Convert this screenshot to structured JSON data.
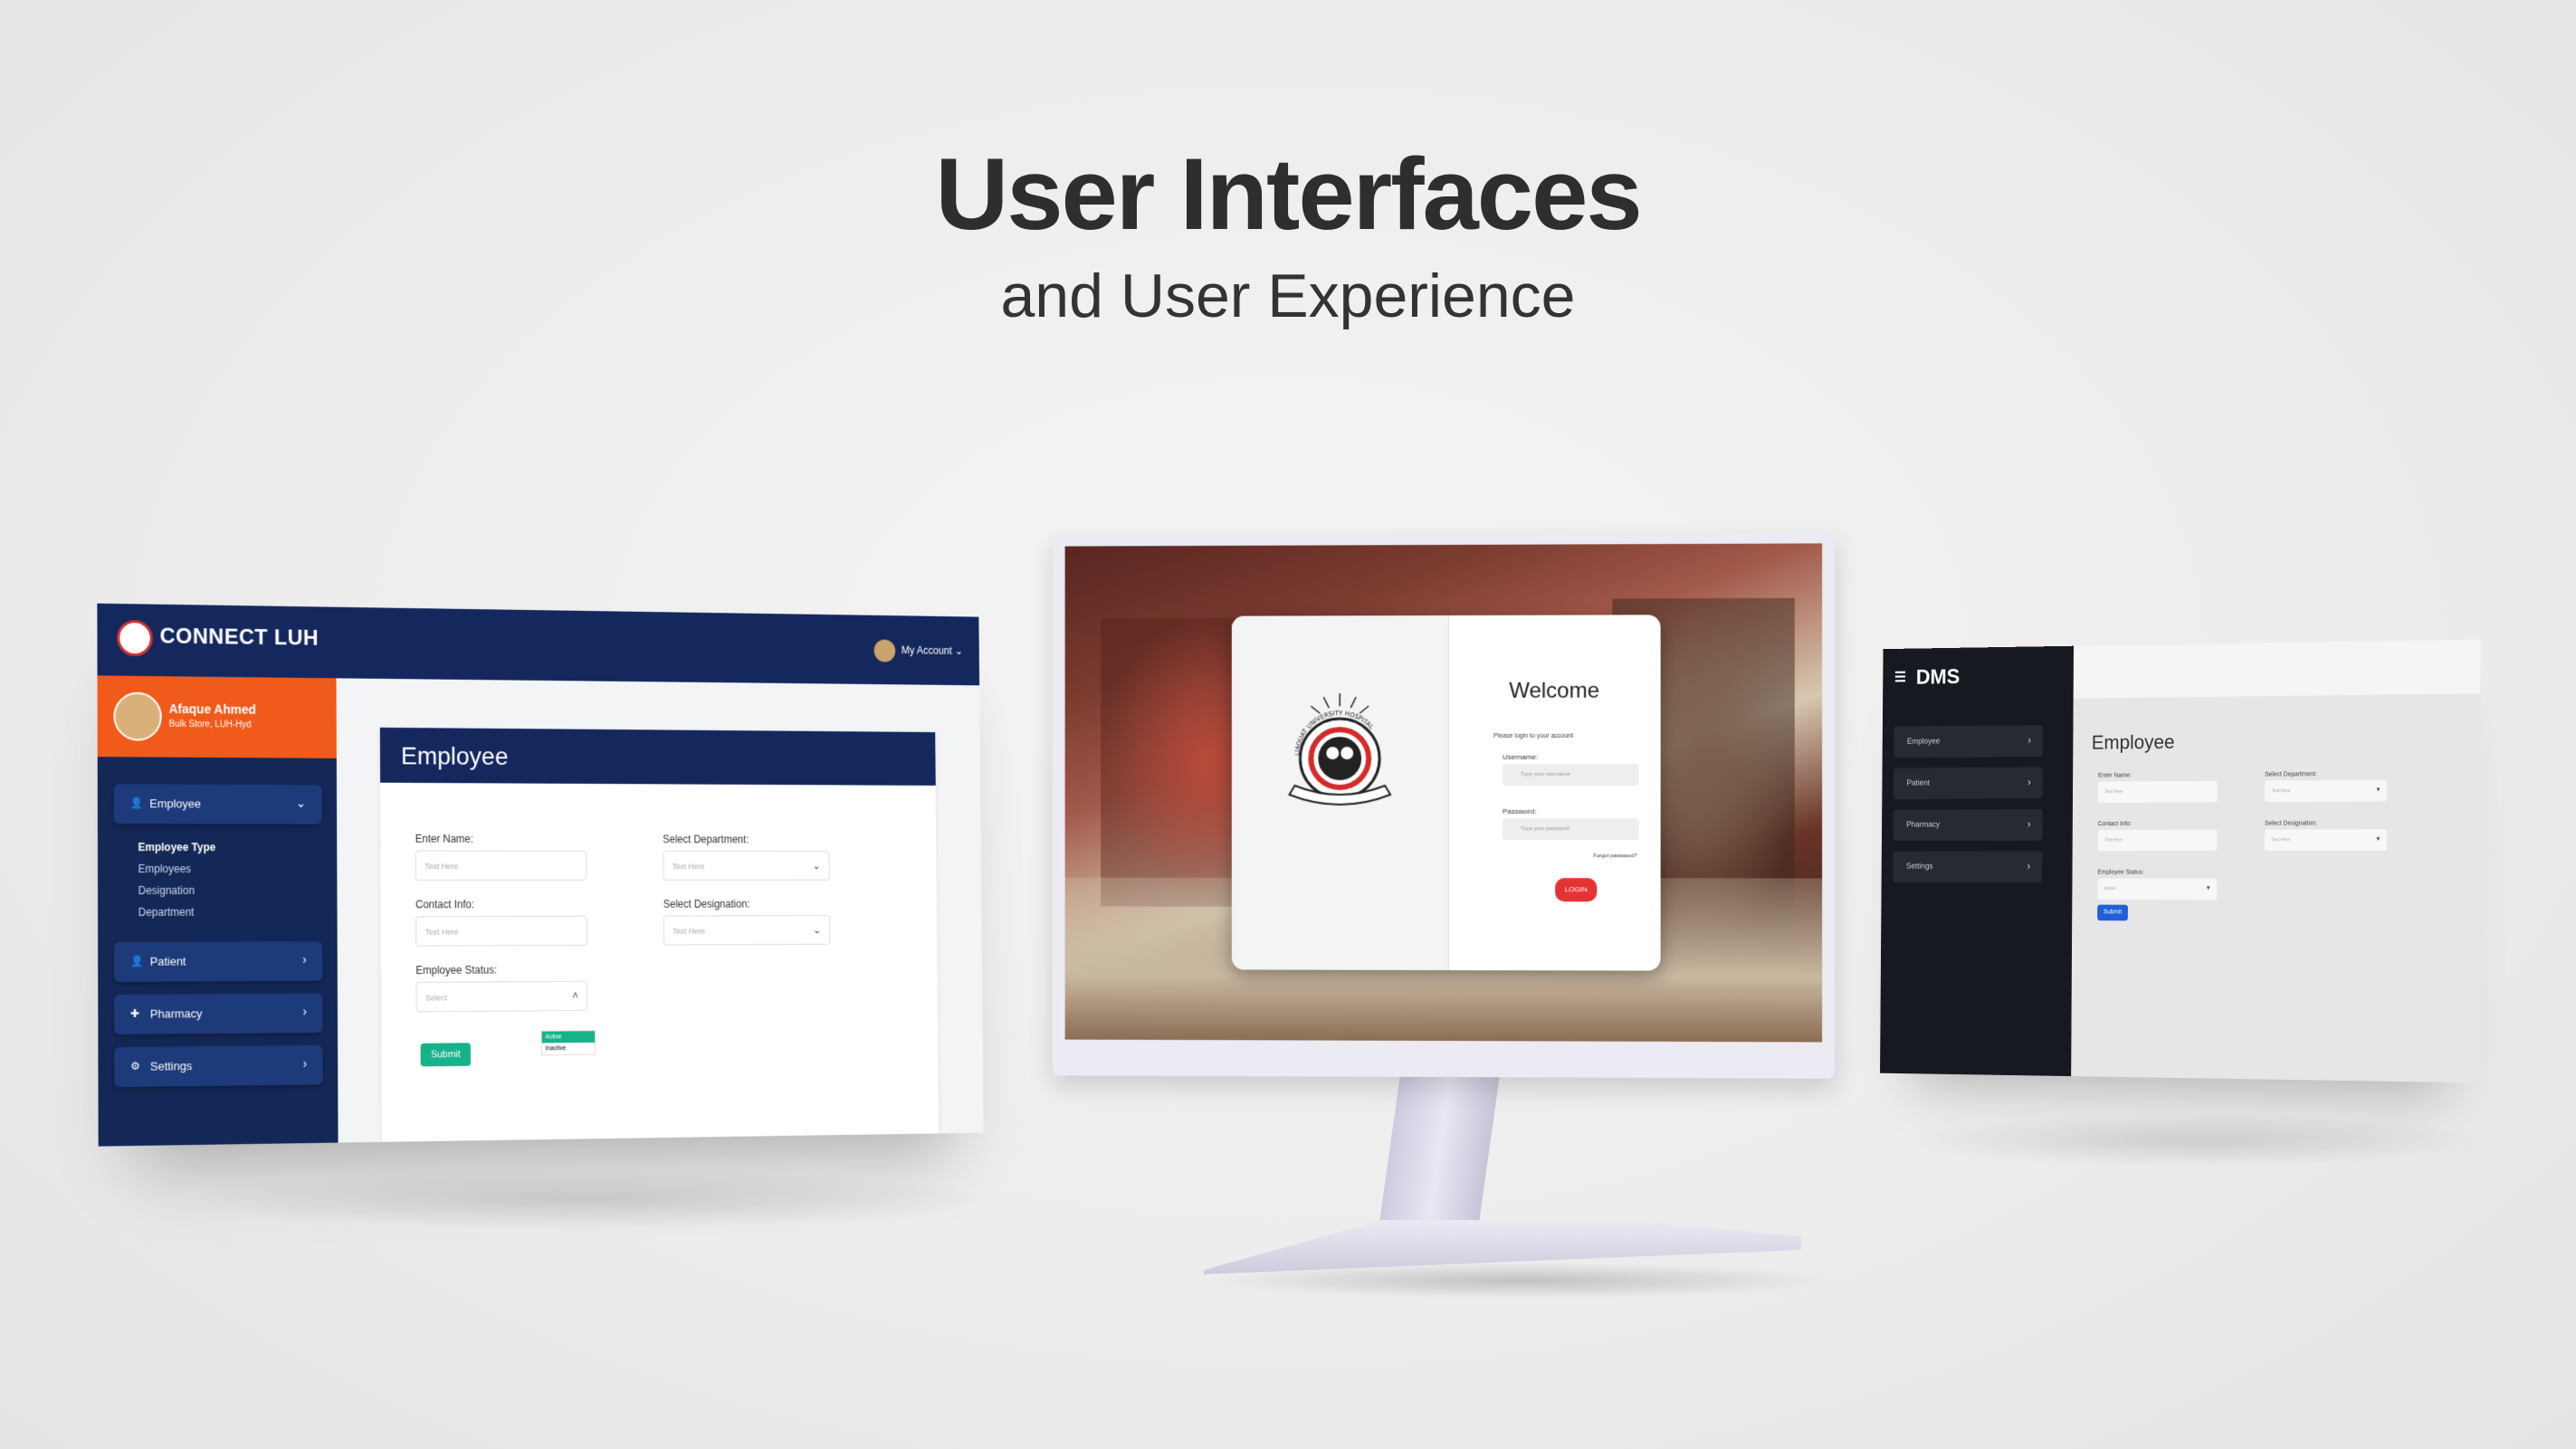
{
  "headline": {
    "title": "User Interfaces",
    "subtitle": "and User Experience"
  },
  "luh": {
    "brand": "CONNECT LUH",
    "account": "My Account",
    "profile": {
      "name": "Afaque Ahmed",
      "sub": "Bulk Store, LUH-Hyd"
    },
    "nav": {
      "employee": "Employee",
      "sub_items": [
        "Employee Type",
        "Employees",
        "Designation",
        "Department"
      ],
      "patient": "Patient",
      "pharmacy": "Pharmacy",
      "settings": "Settings"
    },
    "card_title": "Employee",
    "form": {
      "name_label": "Enter Name:",
      "name_placeholder": "Text Here",
      "contact_label": "Contact Info:",
      "contact_placeholder": "Text Here",
      "status_label": "Employee Status:",
      "status_placeholder": "Select",
      "dept_label": "Select Department:",
      "dept_placeholder": "Text Here",
      "desig_label": "Select Designation:",
      "desig_placeholder": "Text Here",
      "submit": "Submit",
      "status_options": [
        "Active",
        "Inactive"
      ]
    }
  },
  "login": {
    "title": "Welcome",
    "hint": "Please login to your account",
    "username_label": "Username:",
    "username_placeholder": "Type your username",
    "password_label": "Password:",
    "password_placeholder": "Type your password",
    "forgot": "Forgot password?",
    "button": "LOGIN",
    "seal_text": "LIAQUAT UNIVERSITY HOSPITAL",
    "seal_city": "HYDERABAD"
  },
  "dms": {
    "brand": "DMS",
    "nav": [
      "Employee",
      "Patient",
      "Pharmacy",
      "Settings"
    ],
    "title": "Employee",
    "form": {
      "name_label": "Enter Name:",
      "name_placeholder": "Text Here",
      "contact_label": "Contact Info:",
      "contact_placeholder": "Text Here",
      "status_label": "Employee Status:",
      "status_value": "Active",
      "dept_label": "Select Department:",
      "dept_placeholder": "Text Here",
      "desig_label": "Select Designation:",
      "desig_placeholder": "Text Here",
      "submit": "Submit"
    }
  },
  "colors": {
    "navy": "#14285e",
    "orange": "#f05a1a",
    "teal": "#17b28a",
    "red": "#e53333",
    "dms_dark": "#161a20",
    "dms_blue": "#1f5fd8"
  }
}
